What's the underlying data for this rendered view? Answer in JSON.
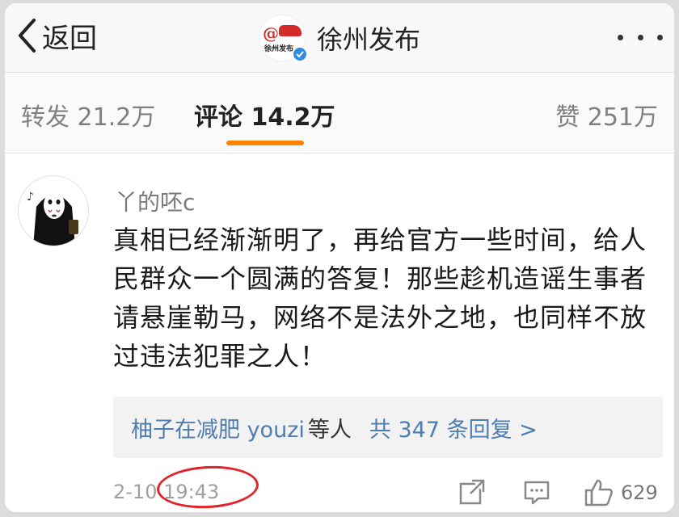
{
  "header": {
    "back_label": "返回",
    "account_name": "徐州发布",
    "account_logo_text": "徐州发布",
    "verified": true,
    "icons": [
      "chevron-left-icon",
      "verified-badge-icon",
      "more-dots-icon"
    ]
  },
  "tabs": [
    {
      "label": "转发 21.2万",
      "active": false
    },
    {
      "label": "评论 14.2万",
      "active": true
    },
    {
      "label": "赞 251万",
      "active": false
    }
  ],
  "comment": {
    "username": "丫的呸c",
    "text": "真相已经渐渐明了，再给官方一些时间，给人民群众一个圆满的答复！那些趁机造谣生事者请悬崖勒马，网络不是法外之地，也同样不放过违法犯罪之人！",
    "replies": {
      "users": "柚子在减肥 youzi",
      "suffix": "等人",
      "count_text": "共 347 条回复 >"
    },
    "timestamp": "2-10 19:43",
    "like_count": "629",
    "action_icons": [
      "share-icon",
      "reply-icon",
      "thumbs-up-icon"
    ]
  },
  "colors": {
    "accent": "#ff8200",
    "link": "#507daf",
    "annotation_circle": "#e0242a",
    "verified": "#2f8ee0"
  }
}
